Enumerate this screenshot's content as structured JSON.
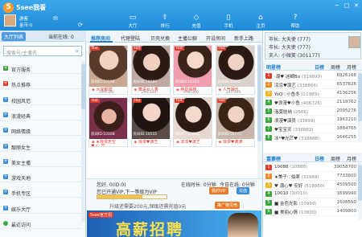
{
  "app": {
    "title": "5see我看",
    "logo_char": "5"
  },
  "user": {
    "name": "游客",
    "coins": "金币:0"
  },
  "nav": [
    {
      "label": "大厅",
      "icon": "▭"
    },
    {
      "label": "排行",
      "icon": "⇧"
    },
    {
      "label": "充值",
      "icon": "◇"
    },
    {
      "label": "手机",
      "icon": "▯"
    },
    {
      "label": "主页",
      "icon": "⌂"
    },
    {
      "label": "帮助",
      "icon": "?"
    }
  ],
  "window": {
    "min": "─",
    "max": "□",
    "close": "✕"
  },
  "left": {
    "tab_label": "大厅列表",
    "online_label": "当前在线: 0",
    "search_placeholder": "搜索号/主播名",
    "items": [
      {
        "label": "官方服务",
        "kind": "green",
        "marker": "+"
      },
      {
        "label": "热点推荐",
        "kind": "hot",
        "marker": "+"
      },
      {
        "label": "校园风范",
        "kind": "blue",
        "marker": "+"
      },
      {
        "label": "浪漫经典",
        "kind": "blue",
        "marker": "+"
      },
      {
        "label": "网络情缘",
        "kind": "blue",
        "marker": "+"
      },
      {
        "label": "靓丽女生",
        "kind": "blue",
        "marker": "+"
      },
      {
        "label": "美女主播",
        "kind": "blue",
        "marker": "+"
      },
      {
        "label": "游戏天地",
        "kind": "blue",
        "marker": "+"
      },
      {
        "label": "手机专区",
        "kind": "blue",
        "marker": "+"
      },
      {
        "label": "娱乐大厅",
        "kind": "blue",
        "marker": "+"
      },
      {
        "label": "最近访问",
        "kind": "last",
        "marker": "·"
      }
    ]
  },
  "center": {
    "tabs": [
      "推荐房间",
      "代理登陆",
      "贝壳兑换",
      "主播公聊",
      "开设房间",
      "新手上路"
    ],
    "cards": [
      {
        "hot": "Hot",
        "room_id": "房间ID:10198",
        "name": "◈ 大家都惜",
        "count": "290/300",
        "photo": "p1"
      },
      {
        "hot": "Hot",
        "room_id": "房间ID:10080",
        "name": "◈ 舞语女人香",
        "count": "294/300",
        "photo": "p2"
      },
      {
        "hot": "Hot",
        "room_id": "房间ID:10333",
        "name": "◈ 绝配阁楼",
        "count": "298/300",
        "photo": "p3"
      },
      {
        "hot": "Hot",
        "room_id": "房间ID:10001",
        "name": "◈ 人气娱乐",
        "count": "297/300",
        "photo": "p4"
      },
      {
        "hot": "Hot",
        "room_id": "房间ID:10108",
        "name": "◈ ★浪漫天空",
        "count": "",
        "photo": "p5",
        "heart": "♥ 心 凹"
      },
      {
        "hot": "Hot",
        "room_id": "房间ID:10555",
        "name": "◈ 浪漫♥演艺",
        "count": "",
        "photo": "p6"
      },
      {
        "hot": "Hot",
        "room_id": "房间ID:10888",
        "name": "◈ 凉凉♥演艺",
        "count": "",
        "photo": "p7"
      },
      {
        "hot": "Hot",
        "room_id": "房间ID:10777",
        "name": "◈ 浪漫♥滴滴",
        "count": "",
        "photo": "p8"
      }
    ],
    "info": {
      "greeting": "您好, 0(ID:0)",
      "online_time": "在线时长: 0分钟",
      "today_online": "今日在线: 0分钟",
      "vip_text": "您已开通VIP,下一等级为VIP",
      "btn_vip": "我的VIP",
      "btn_recharge": "充值",
      "upgrade": "升级还需要200元,保级还需充值0元",
      "btn_level": "推广赚贝壳",
      "progress": 0.65
    },
    "banner": {
      "tag": "5see官方招",
      "text": "高薪招聘"
    }
  },
  "right": {
    "header_lines": [
      "市长: 大天使 (777)",
      "市长: 大天使 (777)",
      "夫人: 小微笑 (301177)"
    ],
    "star": {
      "title": "明星榜",
      "periods": [
        "日榜",
        "周榜",
        "月榜"
      ],
      "rows": [
        {
          "rank": "1",
          "name": "·潮♥ 迷糊Bo",
          "id": "(319899)",
          "val": "6926168"
        },
        {
          "rank": "2",
          "name": "凉凉♥演艺",
          "id": "(338866)",
          "val": "6537826"
        },
        {
          "rank": "3",
          "name": "YoQ♡小鱼冬",
          "id": "(21989)",
          "val": "4136256"
        },
        {
          "rank": "4",
          "name": "♥浪漫♥小鱼",
          "id": "(406726)",
          "val": "2118762"
        },
        {
          "rank": "5",
          "name": "洛莫娃纳",
          "id": "(2666)",
          "val": "2005276"
        },
        {
          "rank": "6",
          "name": "浪漫♥演员",
          "id": "(33899)",
          "val": "1963210"
        },
        {
          "rank": "7",
          "name": "♥宝宝灵",
          "id": "(336882)",
          "val": "1884765"
        },
        {
          "rank": "8",
          "name": "冰*♥光芒♥",
          "id": "(318688)",
          "val": "1646255"
        }
      ]
    },
    "rich": {
      "title": "富豪榜",
      "periods": [
        "日榜",
        "周榜",
        "月榜"
      ],
      "rows": [
        {
          "rank": "1",
          "name": "10088",
          "id": "(10888)",
          "val": "39058700"
        },
        {
          "rank": "2",
          "name": "★美子♡伯寒",
          "id": "(31988)",
          "val": "7733600"
        },
        {
          "rank": "3",
          "name": "♥ 潮心♥ 安好",
          "id": "(518880)",
          "val": "4509500"
        },
        {
          "rank": "4",
          "name": "10010",
          "id": "(10010)",
          "val": "1699990"
        },
        {
          "rank": "5",
          "name": "■ 金色光影",
          "id": "(10999)",
          "val": "1608550"
        },
        {
          "rank": "6",
          "name": "■ 美丽心情",
          "id": "(10800)",
          "val": "1409800"
        }
      ]
    }
  }
}
